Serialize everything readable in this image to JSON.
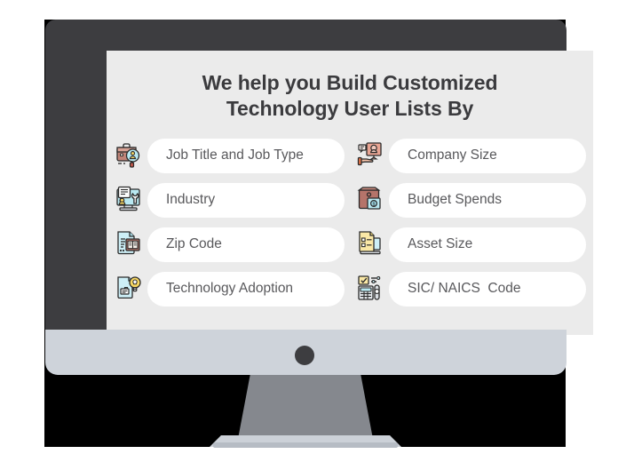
{
  "heading": {
    "line1": "We help you Build Customized",
    "line2": "Technology User Lists By"
  },
  "colors": {
    "bezel": "#3d3d40",
    "screen_bg": "#ebebeb",
    "chin": "#ced3da",
    "pill_bg": "#ffffff",
    "label_text": "#59595c",
    "heading_text": "#3b3b3e",
    "stand": "#85888e",
    "backdrop": "#000000",
    "icon_cyan": "#b9e9f2",
    "icon_brown": "#b5746a",
    "icon_salmon": "#f0a08a",
    "icon_yellow": "#f7d762"
  },
  "items_left": [
    {
      "label": "Job Title and Job Type",
      "icon": "briefcase-person-icon"
    },
    {
      "label": "Industry",
      "icon": "monitor-wrench-icon"
    },
    {
      "label": "Zip Code",
      "icon": "document-book-icon"
    },
    {
      "label": "Technology Adoption",
      "icon": "document-lightbulb-icon"
    }
  ],
  "items_right": [
    {
      "label": "Company Size",
      "icon": "hand-presentation-icon"
    },
    {
      "label": "Budget Spends",
      "icon": "briefcase-money-icon"
    },
    {
      "label": "Asset Size",
      "icon": "laptop-checklist-icon"
    },
    {
      "label": "SIC/ NAICS  Code",
      "icon": "calculator-checklist-icon"
    }
  ],
  "monitor": {
    "power_button": "power-button"
  }
}
